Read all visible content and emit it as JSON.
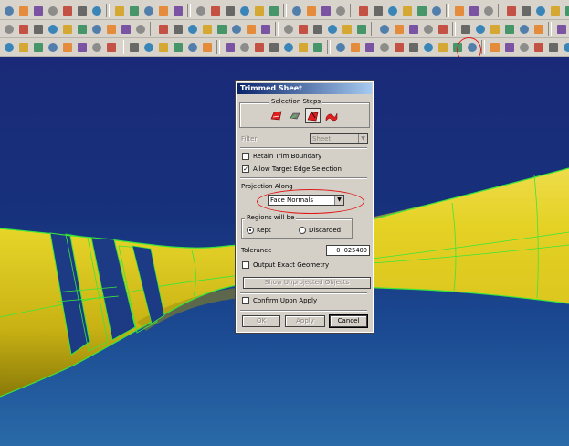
{
  "dialog": {
    "title": "Trimmed Sheet",
    "selection_steps_label": "Selection Steps",
    "filter_label": "Filter",
    "filter_value": "Sheet",
    "retain_trim_boundary": {
      "label": "Retain Trim Boundary",
      "checked": false
    },
    "allow_target_edge": {
      "label": "Allow Target Edge Selection",
      "checked": true
    },
    "projection_along_label": "Projection Along",
    "projection_value": "Face Normals",
    "regions_label": "Regions will be",
    "kept_label": "Kept",
    "discarded_label": "Discarded",
    "regions_selected": "Kept",
    "tolerance_label": "Tolerance",
    "tolerance_value": "0.025400",
    "output_exact": {
      "label": "Output Exact Geometry",
      "checked": false
    },
    "show_unprojected_label": "Show Unprojected Objects",
    "confirm_apply": {
      "label": "Confirm Upon Apply",
      "checked": false
    },
    "ok_label": "OK",
    "apply_label": "Apply",
    "cancel_label": "Cancel"
  },
  "colors": {
    "toolbar_bg": "#d8d4cc",
    "title_bar": "#0a246a",
    "surface_yellow": "#e8d62a",
    "edge_green": "#39e639",
    "highlight_red": "#e01818",
    "viewport_blue": "#1a2a78"
  }
}
